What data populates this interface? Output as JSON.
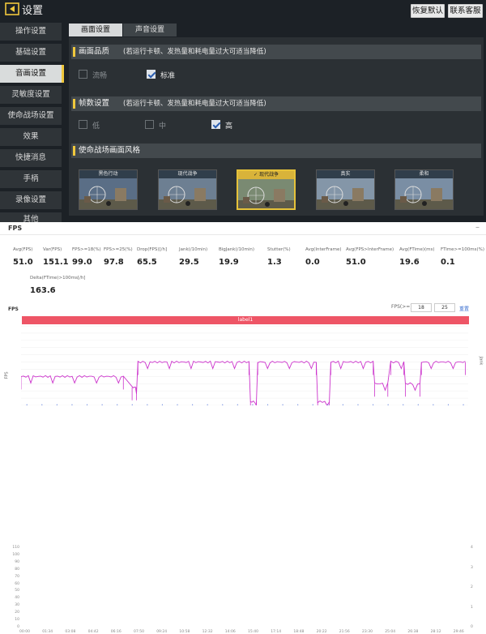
{
  "header": {
    "title": "设置",
    "restore_default": "恢复默认",
    "contact_service": "联系客服"
  },
  "sidebar": {
    "items": [
      {
        "label": "操作设置",
        "active": false
      },
      {
        "label": "基础设置",
        "active": false
      },
      {
        "label": "音画设置",
        "active": true
      },
      {
        "label": "灵敏度设置",
        "active": false
      },
      {
        "label": "使命战场设置",
        "active": false
      },
      {
        "label": "效果",
        "active": false
      },
      {
        "label": "快捷消息",
        "active": false
      },
      {
        "label": "手柄",
        "active": false
      },
      {
        "label": "录像设置",
        "active": false
      },
      {
        "label": "其他",
        "active": false
      }
    ]
  },
  "tabs": [
    {
      "label": "画面设置",
      "active": true
    },
    {
      "label": "声音设置",
      "active": false
    }
  ],
  "quality": {
    "title": "画面品质",
    "hint": "(若运行卡顿、发热量和耗电量过大可适当降低)",
    "options": [
      {
        "label": "流畅",
        "checked": false
      },
      {
        "label": "标准",
        "checked": true
      }
    ]
  },
  "framerate": {
    "title": "帧数设置",
    "hint": "(若运行卡顿、发热量和耗电量过大可适当降低)",
    "options": [
      {
        "label": "低",
        "checked": false
      },
      {
        "label": "中",
        "checked": false
      },
      {
        "label": "高",
        "checked": true
      }
    ]
  },
  "style": {
    "title": "使命战场画面风格",
    "options": [
      {
        "label": "黑色行动",
        "selected": false
      },
      {
        "label": "现代战争",
        "selected": false
      },
      {
        "label": "现代战争",
        "selected": true
      },
      {
        "label": "真实",
        "selected": false
      },
      {
        "label": "柔和",
        "selected": false
      }
    ]
  },
  "perf": {
    "tab_label": "FPS",
    "close_icon": "close-icon",
    "metrics": [
      {
        "label": "Avg(FPS)",
        "value": "51.0"
      },
      {
        "label": "Var(FPS)",
        "value": "151.1"
      },
      {
        "label": "FPS>=18(%)",
        "value": "99.0"
      },
      {
        "label": "FPS>=25(%)",
        "value": "97.8"
      },
      {
        "label": "Drop(FPS)[/h]",
        "value": "65.5"
      },
      {
        "label": "Jank(/10min)",
        "value": "29.5"
      },
      {
        "label": "BigJank(/10min)",
        "value": "19.9"
      },
      {
        "label": "Stutter(%)",
        "value": "1.3"
      },
      {
        "label": "Avg(InterFrame)",
        "value": "0.0"
      },
      {
        "label": "Avg(FPS>InterFrame)",
        "value": "51.0"
      },
      {
        "label": "Avg(FTime)(ms)",
        "value": "19.6"
      },
      {
        "label": "FTime>=100ms(%)",
        "value": "0.1"
      },
      {
        "label": "Delta(FTime)>100ms[/h]",
        "value": "163.6"
      }
    ],
    "chart_title": "FPS",
    "fps_filter_label": "FPS(>=)",
    "fps_filter_a": "18",
    "fps_filter_b": "25",
    "reset_label": "重置",
    "label_bar": "label1",
    "y_axis_label": "FPS",
    "y2_axis_label": "Jank"
  },
  "chart_data": {
    "type": "line",
    "ylim": [
      0,
      110
    ],
    "y2lim": [
      0,
      4
    ],
    "yticks": [
      0,
      10,
      20,
      30,
      40,
      50,
      60,
      70,
      80,
      90,
      100,
      110
    ],
    "y2ticks": [
      0,
      1,
      2,
      3,
      4
    ],
    "xticks": [
      "00:00",
      "01:34",
      "03:08",
      "04:42",
      "06:16",
      "07:50",
      "09:24",
      "10:58",
      "12:32",
      "14:06",
      "15:40",
      "17:14",
      "18:48",
      "20:22",
      "21:56",
      "23:30",
      "25:04",
      "26:38",
      "28:12",
      "29:46"
    ],
    "series": [
      {
        "color": "#cc33cc",
        "segments": [
          {
            "x": [
              0,
              7.0
            ],
            "y": 40
          },
          {
            "x": [
              7.6,
              7.9
            ],
            "y": 25
          },
          {
            "x": [
              8.0,
              15.6
            ],
            "y": 60
          },
          {
            "x": [
              15.7,
              16.1
            ],
            "y": 5
          },
          {
            "x": [
              16.2,
              20.2
            ],
            "y": 60
          },
          {
            "x": [
              20.3,
              21.1
            ],
            "y": 5
          },
          {
            "x": [
              21.2,
              24.1
            ],
            "y": 60
          },
          {
            "x": [
              24.2,
              25.1
            ],
            "y": 30
          },
          {
            "x": [
              25.3,
              26.2
            ],
            "y": 60
          },
          {
            "x": [
              26.3,
              27.3
            ],
            "y": 30
          },
          {
            "x": [
              27.4,
              30.4
            ],
            "y": 60
          }
        ]
      }
    ]
  }
}
